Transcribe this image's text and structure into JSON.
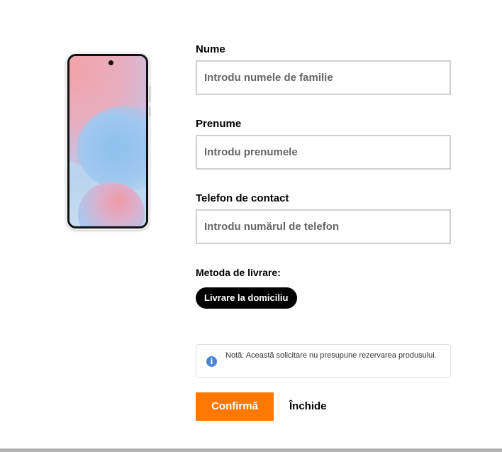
{
  "product": {
    "image_alt": "phone",
    "icon": "smartphone-image"
  },
  "form": {
    "last_name": {
      "label": "Nume",
      "placeholder": "Introdu numele de familie"
    },
    "first_name": {
      "label": "Prenume",
      "placeholder": "Introdu prenumele"
    },
    "phone": {
      "label": "Telefon de contact",
      "placeholder": "Introdu numărul de telefon"
    },
    "delivery": {
      "label": "Metoda de livrare:",
      "option": "Livrare la domiciliu"
    },
    "note": {
      "icon": "info-icon",
      "icon_glyph": "i",
      "text": "Notă: Această solicitare nu presupune rezervarea produsului."
    },
    "actions": {
      "confirm": "Confirmă",
      "close": "Închide"
    }
  },
  "colors": {
    "accent": "#ff7900",
    "pill_bg": "#000000",
    "info": "#4a84d6",
    "input_border": "#cfcfcf"
  }
}
